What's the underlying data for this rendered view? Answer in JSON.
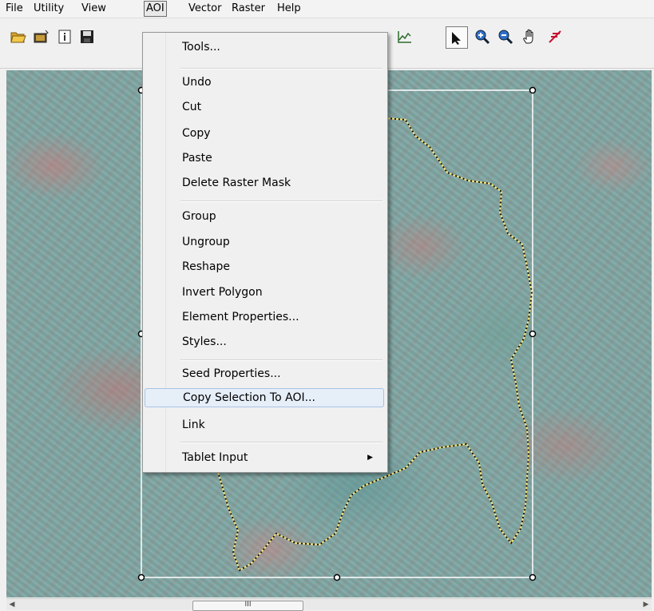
{
  "menubar": {
    "items": [
      "File",
      "Utility",
      "View",
      "AOI",
      "Vector",
      "Raster",
      "Help"
    ],
    "active": "AOI"
  },
  "toolbar": {
    "icons_left": [
      "open-folder-icon",
      "open-layer-icon",
      "info-icon",
      "save-icon"
    ],
    "icons_right": [
      "profile-chart-icon",
      "select-arrow-icon",
      "zoom-in-icon",
      "zoom-out-icon",
      "pan-hand-icon",
      "inquire-cursor-icon"
    ],
    "selected_tool": "select-arrow-icon"
  },
  "aoi_menu": {
    "groups": [
      [
        "Tools..."
      ],
      [
        "Undo",
        "Cut",
        "Copy",
        "Paste",
        "Delete Raster Mask"
      ],
      [
        "Group",
        "Ungroup",
        "Reshape",
        "Invert Polygon",
        "Element Properties...",
        "Styles..."
      ],
      [
        "Seed Properties...",
        "Copy Selection To AOI...",
        "Link"
      ],
      [
        "Tablet Input"
      ]
    ],
    "highlighted": "Copy Selection To AOI...",
    "submenu_item": "Tablet Input"
  },
  "scrollbar": {
    "thumb_label": "III"
  },
  "colors": {
    "imagery_base": "#7fa7a4",
    "selection_box": "#ffffff",
    "boundary_line": "#f3e27a",
    "menu_highlight": "#e6eef8"
  }
}
